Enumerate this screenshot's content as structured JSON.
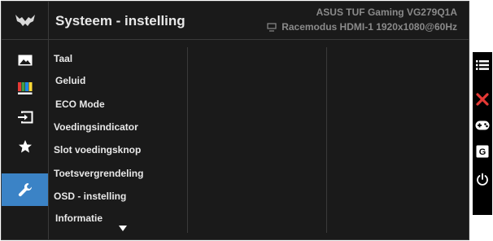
{
  "header": {
    "title": "Systeem - instelling",
    "model": "ASUS TUF Gaming VG279Q1A",
    "status": "Racemodus HDMI-1 1920x1080@60Hz"
  },
  "sidebar": {
    "items": [
      {
        "icon": "image-icon"
      },
      {
        "icon": "color-bars-icon"
      },
      {
        "icon": "input-select-icon"
      },
      {
        "icon": "star-icon"
      },
      {
        "icon": "wrench-icon",
        "active": true
      }
    ]
  },
  "menu": {
    "items": [
      "Taal",
      "Geluid",
      "ECO Mode",
      "Voedingsindicator",
      "Slot voedingsknop",
      "Toetsvergrendeling",
      "OSD - instelling",
      "Informatie"
    ]
  },
  "hotkeys": [
    {
      "icon": "menu-icon"
    },
    {
      "icon": "close-icon"
    },
    {
      "icon": "gamepad-icon"
    },
    {
      "icon": "gameplus-icon",
      "text": "G"
    },
    {
      "icon": "power-icon"
    }
  ],
  "colors": {
    "background": "#1a1a1a",
    "accent": "#3b83c6",
    "close": "#e53935",
    "text": "#e8e8e8",
    "muted": "#8a8a8a"
  }
}
